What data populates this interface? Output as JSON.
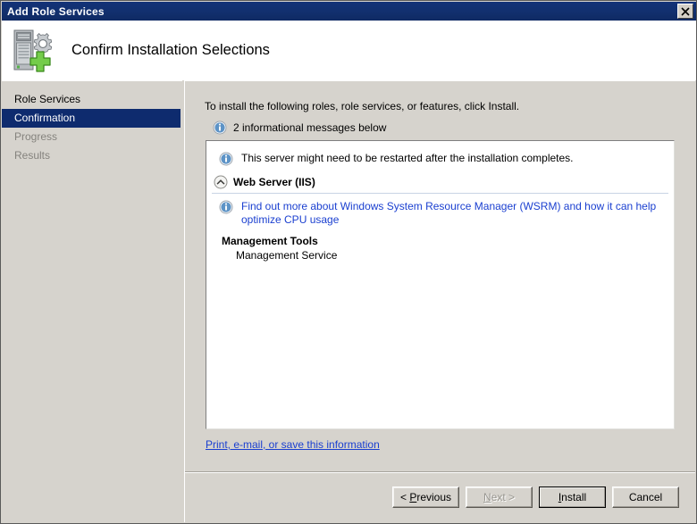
{
  "window": {
    "title": "Add Role Services",
    "close_label": "X",
    "header_title": "Confirm Installation Selections",
    "header_icon": "server-add-icon"
  },
  "sidebar": {
    "items": [
      {
        "label": "Role Services",
        "state": "visited"
      },
      {
        "label": "Confirmation",
        "state": "selected"
      },
      {
        "label": "Progress",
        "state": "disabled"
      },
      {
        "label": "Results",
        "state": "disabled"
      }
    ]
  },
  "main": {
    "intro": "To install the following roles, role services, or features, click Install.",
    "info_summary": "2 informational messages below",
    "info_icon": "info-icon",
    "panel": {
      "restart_notice": "This server might need to be restarted after the installation completes.",
      "section": {
        "collapse_icon": "chevron-up-circle-icon",
        "title": "Web Server (IIS)",
        "info_link": "Find out more about Windows System Resource Manager (WSRM) and how it can help optimize CPU usage",
        "groups": [
          {
            "title": "Management Tools",
            "items": [
              "Management Service"
            ]
          }
        ]
      }
    },
    "print_link": "Print, e-mail, or save this information"
  },
  "footer": {
    "buttons": [
      {
        "label": "< Previous",
        "accel": "P",
        "state": "enabled"
      },
      {
        "label": "Next >",
        "accel": "N",
        "state": "disabled"
      },
      {
        "label": "Install",
        "accel": "I",
        "state": "default"
      },
      {
        "label": "Cancel",
        "accel": "",
        "state": "enabled"
      }
    ]
  },
  "colors": {
    "titlebar": "#12306f",
    "selection": "#0e2b6e",
    "face": "#d6d3cd",
    "link": "#1a3fd0",
    "info_blue": "#3f79b5"
  }
}
